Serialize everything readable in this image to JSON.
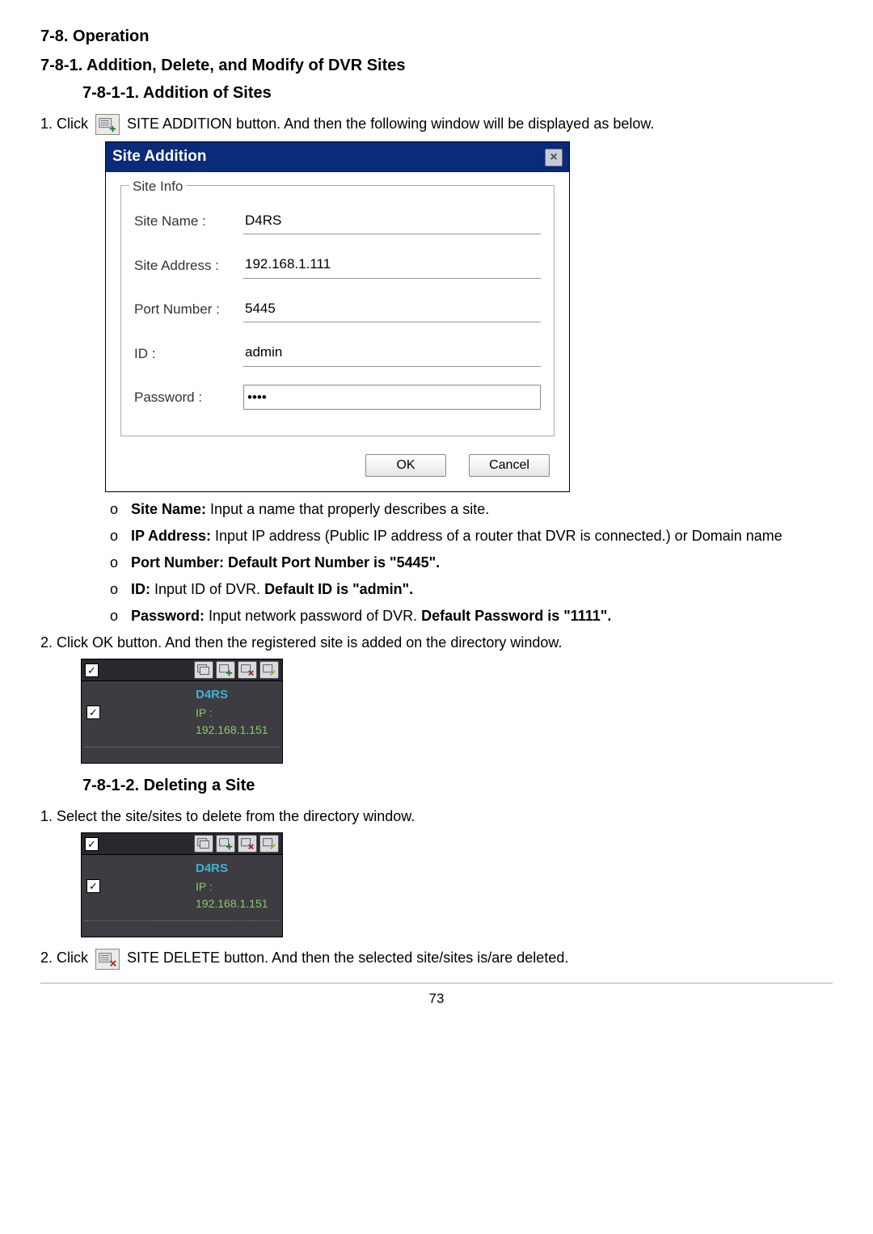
{
  "headings": {
    "operation": "7-8.  Operation",
    "add_del_mod": "7-8-1.  Addition,  Delete,  and  Modify  of  DVR  Sites",
    "addition": "7-8-1-1.  Addition  of  Sites",
    "deleting": "7-8-1-2.  Deleting  a  Site"
  },
  "step1": {
    "prefix": "1. Click ",
    "suffix": " SITE ADDITION button. And then the following window will be displayed as below."
  },
  "dialog": {
    "title": "Site Addition",
    "close": "×",
    "legend": "Site Info",
    "rows": {
      "site_name": {
        "label": "Site Name :",
        "value": "D4RS"
      },
      "site_address": {
        "label": "Site Address :",
        "value": "192.168.1.111"
      },
      "port_number": {
        "label": "Port Number :",
        "value": "5445"
      },
      "id": {
        "label": "ID :",
        "value": "admin"
      },
      "password": {
        "label": "Password :",
        "value": "••••"
      }
    },
    "ok": "OK",
    "cancel": "Cancel"
  },
  "bullets": {
    "site_name": {
      "bold": "Site Name:",
      "rest": " Input a name that properly describes a site."
    },
    "ip_address": {
      "bold": "IP Address:",
      "rest": " Input IP address (Public IP address of a router that DVR is connected.) or Domain name"
    },
    "port_number": {
      "bold": "Port Number: ",
      "rest_bold": "Default Port Number is \"5445\"."
    },
    "id": {
      "bold": "ID:",
      "rest": " Input ID of DVR. ",
      "rest_bold": "Default ID is \"admin\"."
    },
    "password": {
      "bold": "Password:",
      "rest": " Input network password of DVR. ",
      "rest_bold": "Default Password is \"1111\"."
    }
  },
  "step2": "2. Click OK button. And then the registered site is added on the directory window.",
  "dir": {
    "check": "✓",
    "site_name": "D4RS",
    "ip_label": "IP : 192.168.1.151"
  },
  "delete_section": {
    "step1": "1. Select the site/sites to delete from the directory window.",
    "step2_prefix": "2. Click ",
    "step2_suffix": " SITE DELETE button. And then the selected site/sites is/are deleted."
  },
  "page_number": "73"
}
